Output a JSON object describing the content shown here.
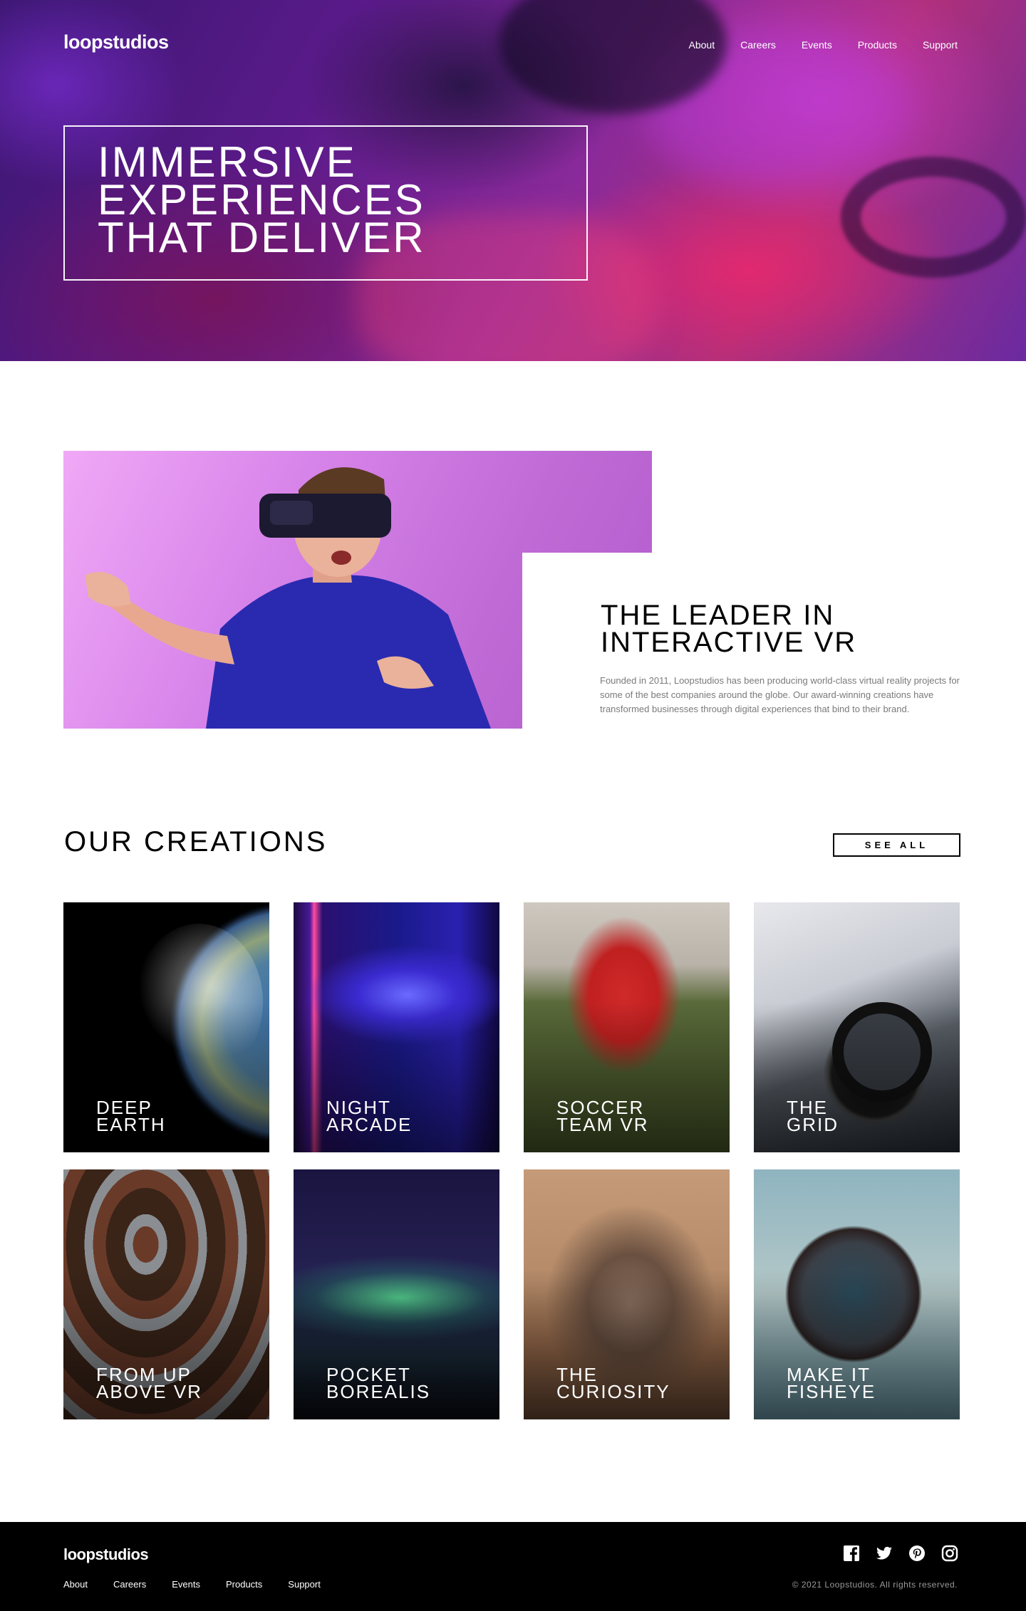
{
  "brand": {
    "logo": "loopstudios"
  },
  "header": {
    "nav": [
      "About",
      "Careers",
      "Events",
      "Products",
      "Support"
    ]
  },
  "hero": {
    "title": "IMMERSIVE\nEXPERIENCES\nTHAT DELIVER"
  },
  "intro": {
    "title": "THE LEADER IN\nINTERACTIVE VR",
    "text": "Founded in 2011, Loopstudios has been producing world-class virtual reality projects for some of the best companies around the globe. Our award-winning creations have transformed businesses through digital experiences that bind to their brand."
  },
  "creations": {
    "title": "OUR CREATIONS",
    "see_all": "SEE ALL",
    "items": [
      {
        "label": "DEEP\nEARTH"
      },
      {
        "label": "NIGHT\nARCADE"
      },
      {
        "label": "SOCCER\nTEAM VR"
      },
      {
        "label": "THE\nGRID"
      },
      {
        "label": "FROM UP\nABOVE VR"
      },
      {
        "label": "POCKET\nBOREALIS"
      },
      {
        "label": "THE\nCURIOSITY"
      },
      {
        "label": "MAKE IT\nFISHEYE"
      }
    ]
  },
  "footer": {
    "logo": "loopstudios",
    "nav": [
      "About",
      "Careers",
      "Events",
      "Products",
      "Support"
    ],
    "copyright": "© 2021 Loopstudios. All rights reserved.",
    "social_icons": [
      "facebook-icon",
      "twitter-icon",
      "pinterest-icon",
      "instagram-icon"
    ]
  }
}
